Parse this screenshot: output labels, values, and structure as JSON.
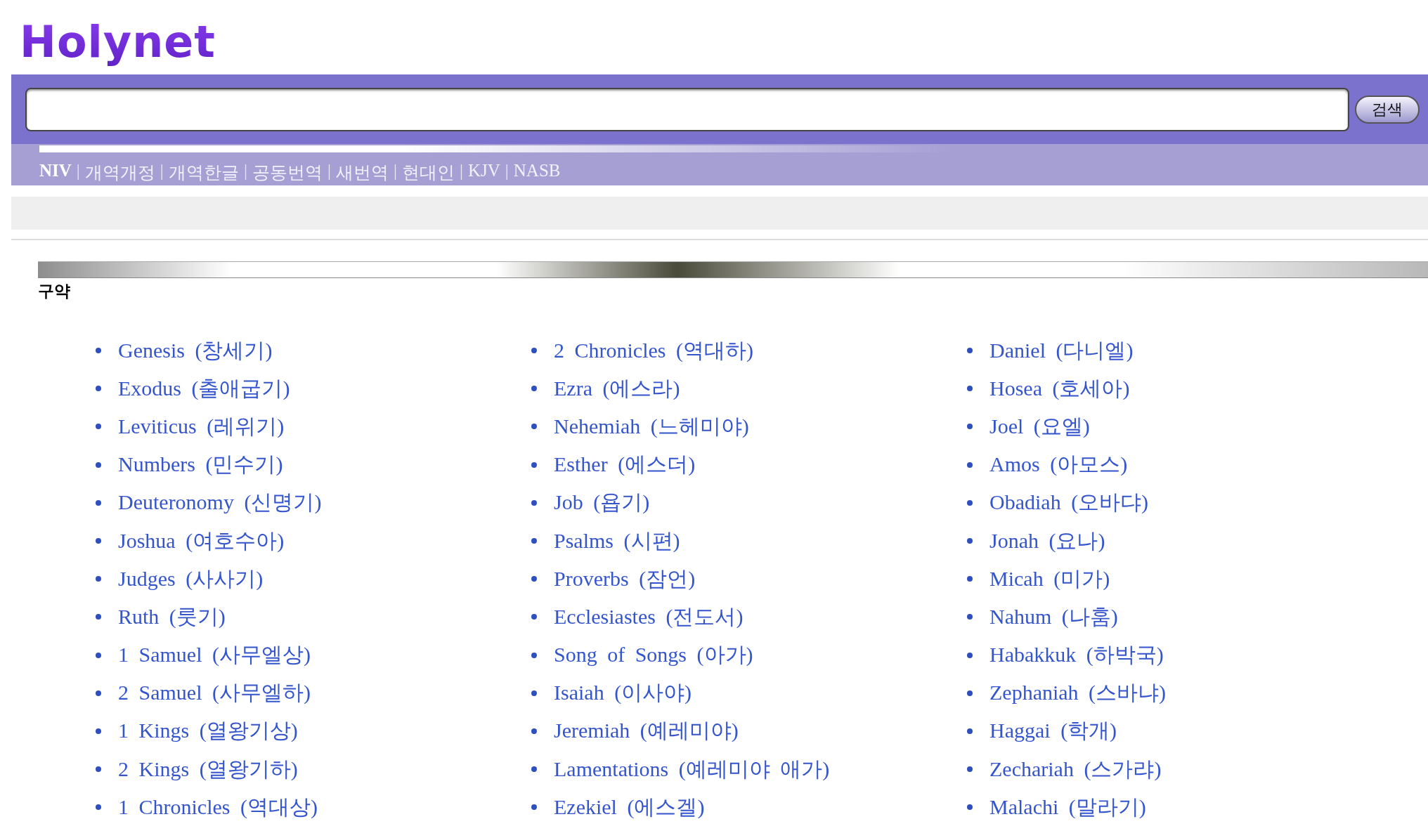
{
  "logo": "Holynet",
  "search": {
    "button": "검색"
  },
  "versions": [
    {
      "label": "NIV",
      "selected": true
    },
    {
      "label": "개역개정",
      "selected": false
    },
    {
      "label": "개역한글",
      "selected": false
    },
    {
      "label": "공동번역",
      "selected": false
    },
    {
      "label": "새번역",
      "selected": false
    },
    {
      "label": "현대인",
      "selected": false
    },
    {
      "label": "KJV",
      "selected": false
    },
    {
      "label": "NASB",
      "selected": false
    }
  ],
  "version_separators": [
    "|",
    "|",
    "|",
    "|",
    "|",
    "|",
    "|"
  ],
  "section": {
    "title": "구약",
    "columns": [
      [
        "Genesis (창세기)",
        "Exodus (출애굽기)",
        "Leviticus (레위기)",
        "Numbers (민수기)",
        "Deuteronomy (신명기)",
        "Joshua (여호수아)",
        "Judges (사사기)",
        "Ruth (룻기)",
        "1 Samuel (사무엘상)",
        "2 Samuel (사무엘하)",
        "1 Kings (열왕기상)",
        "2 Kings (열왕기하)",
        "1 Chronicles (역대상)"
      ],
      [
        "2 Chronicles (역대하)",
        "Ezra (에스라)",
        "Nehemiah (느헤미야)",
        "Esther (에스더)",
        "Job (욥기)",
        "Psalms (시편)",
        "Proverbs (잠언)",
        "Ecclesiastes (전도서)",
        "Song of Songs (아가)",
        "Isaiah (이사야)",
        "Jeremiah (예레미야)",
        "Lamentations (예레미야 애가)",
        "Ezekiel (에스겔)"
      ],
      [
        "Daniel (다니엘)",
        "Hosea (호세아)",
        "Joel (요엘)",
        "Amos (아모스)",
        "Obadiah (오바댜)",
        "Jonah (요나)",
        "Micah (미가)",
        "Nahum (나훔)",
        "Habakkuk (하박국)",
        "Zephaniah (스바냐)",
        "Haggai (학개)",
        "Zechariah (스가랴)",
        "Malachi (말라기)"
      ]
    ]
  }
}
